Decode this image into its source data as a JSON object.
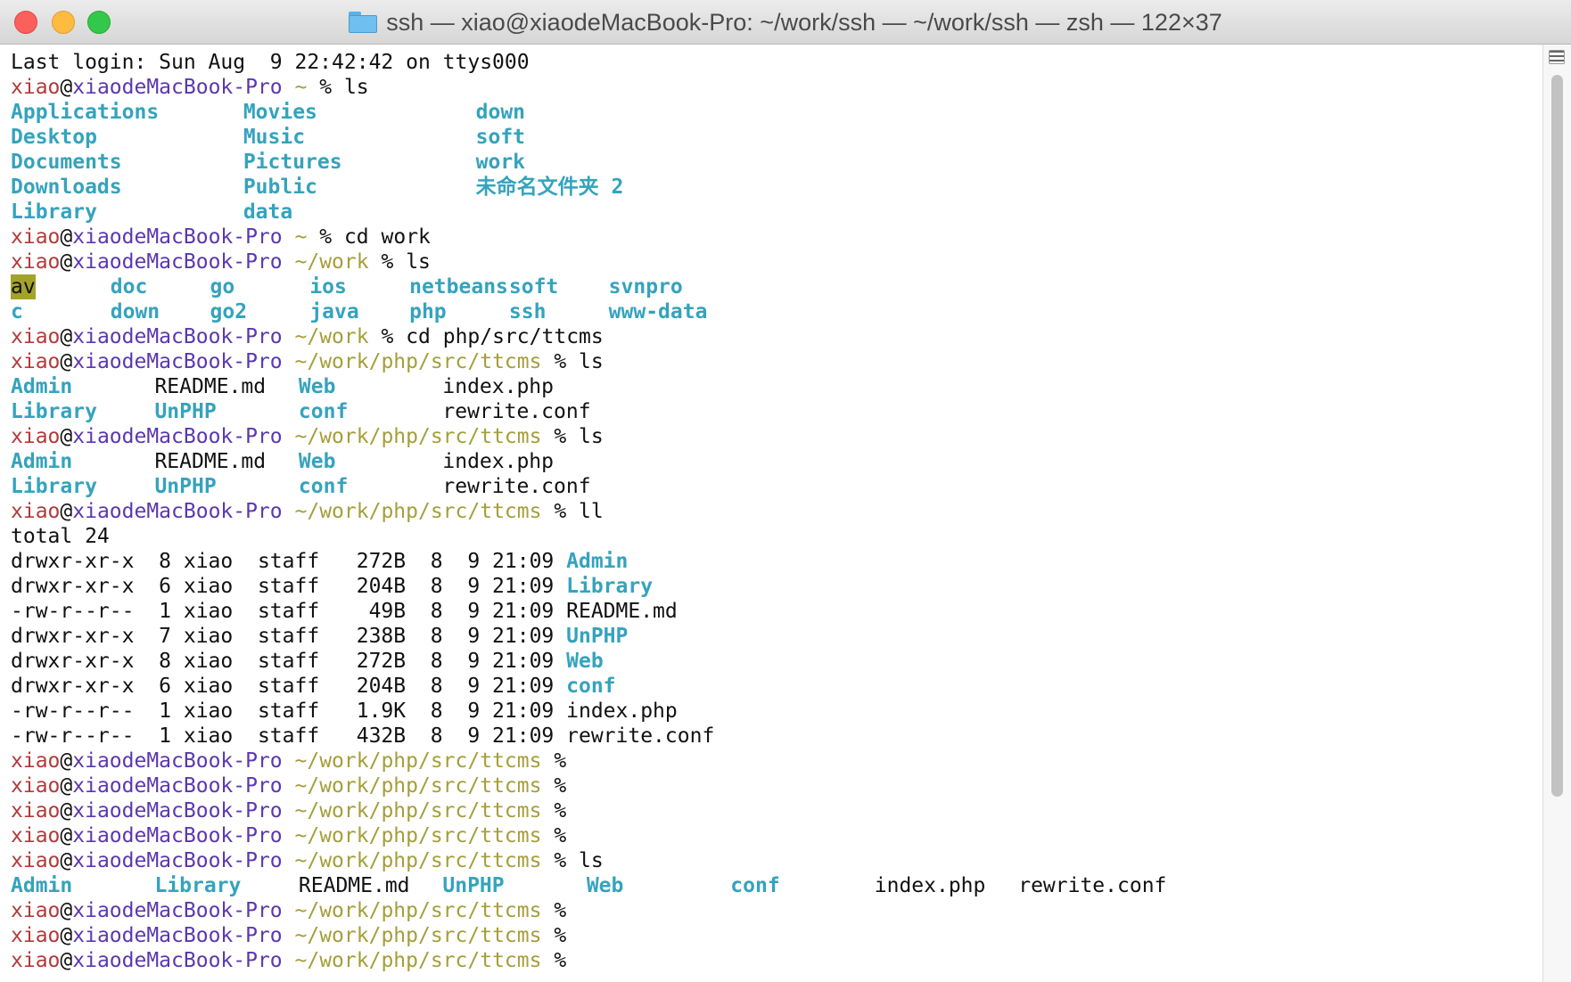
{
  "window": {
    "title": "ssh — xiao@xiaodeMacBook-Pro: ~/work/ssh — ~/work/ssh — zsh — 122×37"
  },
  "prompt": {
    "user": "xiao",
    "at": "@",
    "host": "xiaodeMacBook-Pro",
    "sign": "%"
  },
  "lines": [
    {
      "type": "text",
      "text": "Last login: Sun Aug  9 22:42:42 on ttys000"
    },
    {
      "type": "prompt",
      "path": "~",
      "cmd": "ls"
    },
    {
      "type": "cols",
      "cells": [
        {
          "t": "Applications",
          "c": "dir",
          "col": 0
        },
        {
          "t": "Movies",
          "c": "dir",
          "col": 21
        },
        {
          "t": "down",
          "c": "dir",
          "col": 42
        }
      ]
    },
    {
      "type": "cols",
      "cells": [
        {
          "t": "Desktop",
          "c": "dir",
          "col": 0
        },
        {
          "t": "Music",
          "c": "dir",
          "col": 21
        },
        {
          "t": "soft",
          "c": "dir",
          "col": 42
        }
      ]
    },
    {
      "type": "cols",
      "cells": [
        {
          "t": "Documents",
          "c": "dir",
          "col": 0
        },
        {
          "t": "Pictures",
          "c": "dir",
          "col": 21
        },
        {
          "t": "work",
          "c": "dir",
          "col": 42
        }
      ]
    },
    {
      "type": "cols",
      "cells": [
        {
          "t": "Downloads",
          "c": "dir",
          "col": 0
        },
        {
          "t": "Public",
          "c": "dir",
          "col": 21
        },
        {
          "t": "未命名文件夹 2",
          "c": "dir",
          "col": 42
        }
      ]
    },
    {
      "type": "cols",
      "cells": [
        {
          "t": "Library",
          "c": "dir",
          "col": 0
        },
        {
          "t": "data",
          "c": "dir",
          "col": 21
        }
      ]
    },
    {
      "type": "prompt",
      "path": "~",
      "cmd": "cd work"
    },
    {
      "type": "prompt",
      "path": "~/work",
      "cmd": "ls"
    },
    {
      "type": "cols",
      "cells": [
        {
          "t": "av",
          "c": "hl",
          "col": 0
        },
        {
          "t": "doc",
          "c": "dir",
          "col": 9
        },
        {
          "t": "go",
          "c": "dir",
          "col": 18
        },
        {
          "t": "ios",
          "c": "dir",
          "col": 27
        },
        {
          "t": "netbeans",
          "c": "dir",
          "col": 36
        },
        {
          "t": "soft",
          "c": "dir",
          "col": 45
        },
        {
          "t": "svnpro",
          "c": "dir",
          "col": 54
        }
      ]
    },
    {
      "type": "cols",
      "cells": [
        {
          "t": "c",
          "c": "dir",
          "col": 0
        },
        {
          "t": "down",
          "c": "dir",
          "col": 9
        },
        {
          "t": "go2",
          "c": "dir",
          "col": 18
        },
        {
          "t": "java",
          "c": "dir",
          "col": 27
        },
        {
          "t": "php",
          "c": "dir",
          "col": 36
        },
        {
          "t": "ssh",
          "c": "dir",
          "col": 45
        },
        {
          "t": "www-data",
          "c": "dir",
          "col": 54
        }
      ]
    },
    {
      "type": "prompt",
      "path": "~/work",
      "cmd": "cd php/src/ttcms"
    },
    {
      "type": "prompt",
      "path": "~/work/php/src/ttcms",
      "cmd": "ls"
    },
    {
      "type": "cols",
      "cells": [
        {
          "t": "Admin",
          "c": "dir",
          "col": 0
        },
        {
          "t": "README.md",
          "c": "file",
          "col": 13
        },
        {
          "t": "Web",
          "c": "dir",
          "col": 26
        },
        {
          "t": "index.php",
          "c": "file",
          "col": 39
        }
      ]
    },
    {
      "type": "cols",
      "cells": [
        {
          "t": "Library",
          "c": "dir",
          "col": 0
        },
        {
          "t": "UnPHP",
          "c": "dir",
          "col": 13
        },
        {
          "t": "conf",
          "c": "dir",
          "col": 26
        },
        {
          "t": "rewrite.conf",
          "c": "file",
          "col": 39
        }
      ]
    },
    {
      "type": "prompt",
      "path": "~/work/php/src/ttcms",
      "cmd": "ls"
    },
    {
      "type": "cols",
      "cells": [
        {
          "t": "Admin",
          "c": "dir",
          "col": 0
        },
        {
          "t": "README.md",
          "c": "file",
          "col": 13
        },
        {
          "t": "Web",
          "c": "dir",
          "col": 26
        },
        {
          "t": "index.php",
          "c": "file",
          "col": 39
        }
      ]
    },
    {
      "type": "cols",
      "cells": [
        {
          "t": "Library",
          "c": "dir",
          "col": 0
        },
        {
          "t": "UnPHP",
          "c": "dir",
          "col": 13
        },
        {
          "t": "conf",
          "c": "dir",
          "col": 26
        },
        {
          "t": "rewrite.conf",
          "c": "file",
          "col": 39
        }
      ]
    },
    {
      "type": "prompt",
      "path": "~/work/php/src/ttcms",
      "cmd": "ll"
    },
    {
      "type": "text",
      "text": "total 24"
    },
    {
      "type": "ll",
      "meta": "drwxr-xr-x  8 xiao  staff   272B  8  9 21:09 ",
      "name": "Admin",
      "c": "dir"
    },
    {
      "type": "ll",
      "meta": "drwxr-xr-x  6 xiao  staff   204B  8  9 21:09 ",
      "name": "Library",
      "c": "dir"
    },
    {
      "type": "ll",
      "meta": "-rw-r--r--  1 xiao  staff    49B  8  9 21:09 ",
      "name": "README.md",
      "c": "file"
    },
    {
      "type": "ll",
      "meta": "drwxr-xr-x  7 xiao  staff   238B  8  9 21:09 ",
      "name": "UnPHP",
      "c": "dir"
    },
    {
      "type": "ll",
      "meta": "drwxr-xr-x  8 xiao  staff   272B  8  9 21:09 ",
      "name": "Web",
      "c": "dir"
    },
    {
      "type": "ll",
      "meta": "drwxr-xr-x  6 xiao  staff   204B  8  9 21:09 ",
      "name": "conf",
      "c": "dir"
    },
    {
      "type": "ll",
      "meta": "-rw-r--r--  1 xiao  staff   1.9K  8  9 21:09 ",
      "name": "index.php",
      "c": "file"
    },
    {
      "type": "ll",
      "meta": "-rw-r--r--  1 xiao  staff   432B  8  9 21:09 ",
      "name": "rewrite.conf",
      "c": "file"
    },
    {
      "type": "prompt",
      "path": "~/work/php/src/ttcms",
      "cmd": ""
    },
    {
      "type": "prompt",
      "path": "~/work/php/src/ttcms",
      "cmd": ""
    },
    {
      "type": "prompt",
      "path": "~/work/php/src/ttcms",
      "cmd": ""
    },
    {
      "type": "prompt",
      "path": "~/work/php/src/ttcms",
      "cmd": ""
    },
    {
      "type": "prompt",
      "path": "~/work/php/src/ttcms",
      "cmd": "ls"
    },
    {
      "type": "cols",
      "cells": [
        {
          "t": "Admin",
          "c": "dir",
          "col": 0
        },
        {
          "t": "Library",
          "c": "dir",
          "col": 13
        },
        {
          "t": "README.md",
          "c": "file",
          "col": 26
        },
        {
          "t": "UnPHP",
          "c": "dir",
          "col": 39
        },
        {
          "t": "Web",
          "c": "dir",
          "col": 52
        },
        {
          "t": "conf",
          "c": "dir",
          "col": 65
        },
        {
          "t": "index.php",
          "c": "file",
          "col": 78
        },
        {
          "t": "rewrite.conf",
          "c": "file",
          "col": 91
        }
      ]
    },
    {
      "type": "prompt",
      "path": "~/work/php/src/ttcms",
      "cmd": ""
    },
    {
      "type": "prompt",
      "path": "~/work/php/src/ttcms",
      "cmd": ""
    },
    {
      "type": "prompt",
      "path": "~/work/php/src/ttcms",
      "cmd": ""
    }
  ],
  "colors": {
    "user": "#b23a3a",
    "host": "#5b37b0",
    "path": "#a59e3a",
    "directory": "#35a3bd",
    "highlight": "#a3a32a"
  },
  "icons": [
    "folder-icon",
    "close-icon",
    "minimize-icon",
    "zoom-icon",
    "scrollback-icon"
  ]
}
